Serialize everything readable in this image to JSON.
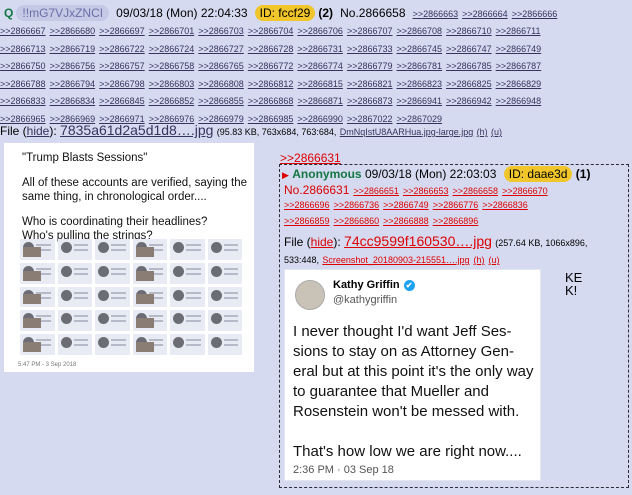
{
  "post": {
    "q_mark": "Q",
    "tripcode": "!!mG7VJxZNCI",
    "datetime": "09/03/18 (Mon) 22:04:33",
    "id_badge": "ID: fccf29",
    "count": "(2)",
    "number": "No.2866658",
    "header_replies": [
      ">>2866663",
      ">>2866664",
      ">>2866666"
    ],
    "replies": [
      [
        ">>2866667",
        ">>2866680",
        ">>2866697",
        ">>2866701",
        ">>2866703",
        ">>2866704",
        ">>2866706",
        ">>2866707",
        ">>2866708",
        ">>2866710",
        ">>2866711"
      ],
      [
        ">>2866713",
        ">>2866719",
        ">>2866722",
        ">>2866724",
        ">>2866727",
        ">>2866728",
        ">>2866731",
        ">>2866733",
        ">>2866745",
        ">>2866747",
        ">>2866749"
      ],
      [
        ">>2866750",
        ">>2866756",
        ">>2866757",
        ">>2866758",
        ">>2866765",
        ">>2866772",
        ">>2866774",
        ">>2866779",
        ">>2866781",
        ">>2866785",
        ">>2866787"
      ],
      [
        ">>2866788",
        ">>2866794",
        ">>2866798",
        ">>2866803",
        ">>2866808",
        ">>2866812",
        ">>2866815",
        ">>2866821",
        ">>2866823",
        ">>2866825",
        ">>2866829"
      ],
      [
        ">>2866833",
        ">>2866834",
        ">>2866845",
        ">>2866852",
        ">>2866855",
        ">>2866868",
        ">>2866871",
        ">>2866873",
        ">>2866941",
        ">>2866942",
        ">>2866948"
      ],
      [
        ">>2866965",
        ">>2866969",
        ">>2866971",
        ">>2866976",
        ">>2866979",
        ">>2866985",
        ">>2866990",
        ">>2867022",
        ">>2867029"
      ]
    ],
    "file": {
      "prefix": "File (",
      "hide": "hide",
      "close": "):",
      "name": "7835a61d2a5d1d8….jpg",
      "meta": "(95.83 KB, 763x684, 763:684,",
      "orig": "DmNqIstU8AARHua.jpg-large.jpg",
      "h": "(h)",
      "u": "(u)"
    },
    "image": {
      "title": "\"Trump Blasts Sessions\"",
      "line1": "All of these accounts are verified, saying the",
      "line2": "same thing, in chronological order....",
      "line3": "Who is coordinating their headlines?",
      "line4": "Who's pulling the strings?",
      "timestamp": "5:47 PM - 3 Sep 2018"
    }
  },
  "reply": {
    "quote": ">>2866631",
    "arrow": "▶",
    "name": "Anonymous",
    "datetime": "09/03/18 (Mon) 22:03:03",
    "id_badge": "ID: daae3d",
    "count": "(1)",
    "number": "No.2866631",
    "reply_rows": [
      [
        ">>2866651",
        ">>2866653",
        ">>2866658",
        ">>2866670"
      ],
      [
        ">>2866696",
        ">>2866736",
        ">>2866749",
        ">>2866776",
        ">>2866836"
      ],
      [
        ">>2866859",
        ">>2866860",
        ">>2866888",
        ">>2866896"
      ]
    ],
    "file": {
      "prefix": "File (",
      "hide": "hide",
      "close": "):",
      "name": "74cc9599f160530….jpg",
      "meta1": "(257.64 KB, 1066x896,",
      "meta2": "533:448,",
      "orig": "Screenshot_20180903-215551….jpg",
      "h": "(h)",
      "u": "(u)"
    },
    "tweet": {
      "name": "Kathy Griffin",
      "verified": "✔",
      "handle": "@kathygriffin",
      "text": "I never thought I'd want Jeff Ses-sions to stay on as Attorney Gen-eral but at this point it's the only way to guarantee that Mueller and Rosenstein won't be messed with.",
      "text2": "That's how low we are right now....",
      "timestamp": "2:36 PM · 03 Sep 18"
    },
    "comment_line1": "KE",
    "comment_line2": "K!"
  }
}
